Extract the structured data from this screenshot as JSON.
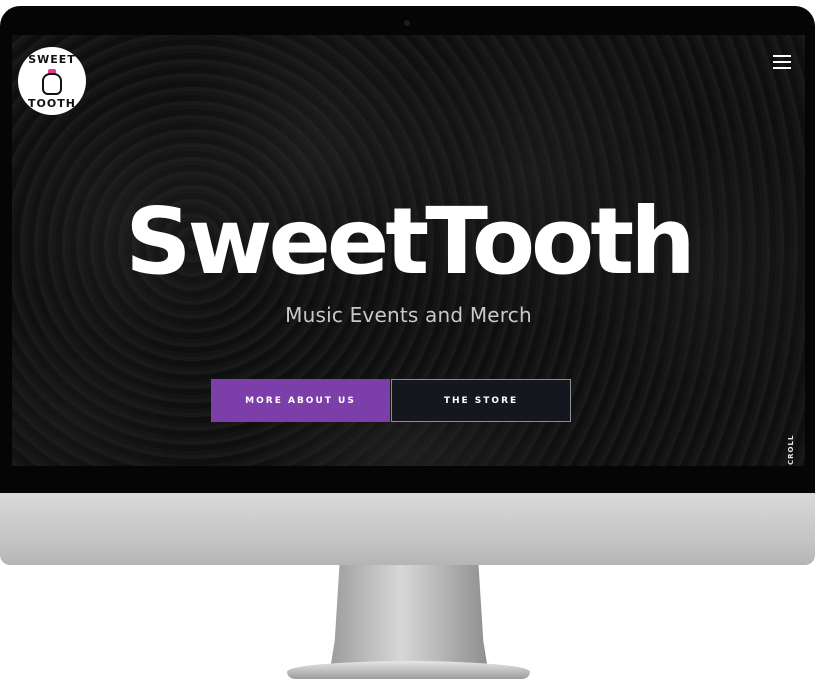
{
  "logo": {
    "top_text": "SWEET",
    "bottom_text": "TOOTH",
    "bow_color": "#e63a86"
  },
  "nav": {
    "menu_icon": "hamburger-menu-icon"
  },
  "hero": {
    "title": "SweetTooth",
    "subtitle": "Music Events and Merch"
  },
  "buttons": {
    "primary_label": "MORE ABOUT US",
    "secondary_label": "THE STORE",
    "primary_color": "#7c3fa9",
    "secondary_color": "#14171d"
  },
  "scroll": {
    "label": "CROLL"
  }
}
